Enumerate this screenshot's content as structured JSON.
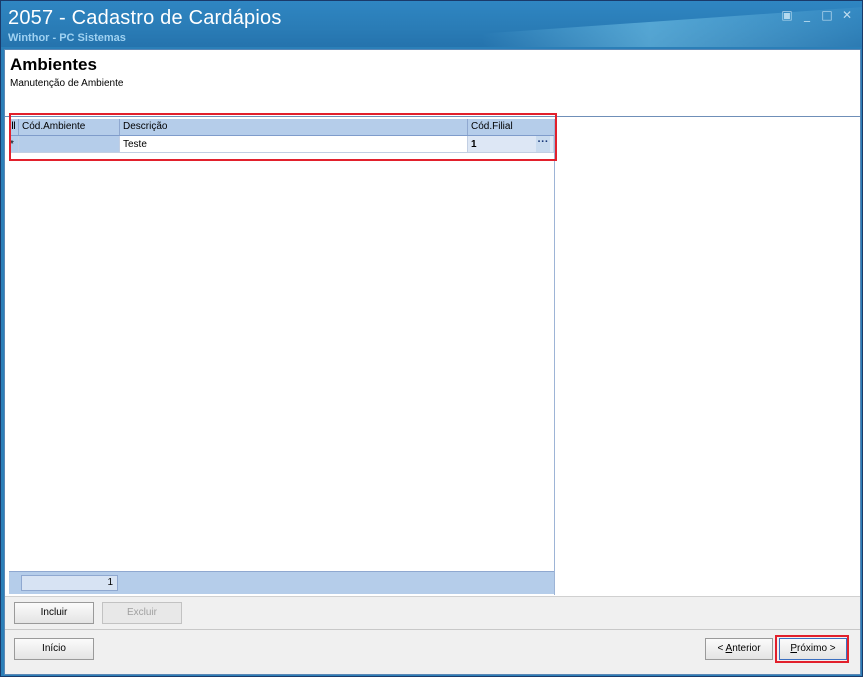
{
  "window": {
    "title": "2057 - Cadastro de Cardápios",
    "subtitle": "Winthor - PC Sistemas",
    "controls": {
      "restore": "▣",
      "minimize": "_",
      "maximize": "□",
      "close": "✕"
    }
  },
  "header": {
    "title": "Ambientes",
    "description": "Manutenção de Ambiente"
  },
  "grid": {
    "columns": [
      "Cód.Ambiente",
      "Descrição",
      "Cód.Filial"
    ],
    "rows": [
      {
        "indicator": "*",
        "cod_ambiente": "",
        "descricao": "Teste",
        "cod_filial": "1"
      }
    ],
    "ellipsis": "···",
    "footer_count": "1"
  },
  "toolbar": {
    "incluir": "Incluir",
    "excluir": "Excluir"
  },
  "nav": {
    "inicio": "Início",
    "anterior_prefix": "< ",
    "anterior_mnemonic": "A",
    "anterior_rest": "nterior",
    "proximo_mnemonic": "P",
    "proximo_rest": "róximo >"
  },
  "colors": {
    "title_bar": "#2b7fb8",
    "grid_header": "#b5cdea",
    "highlight": "#e2202c"
  }
}
